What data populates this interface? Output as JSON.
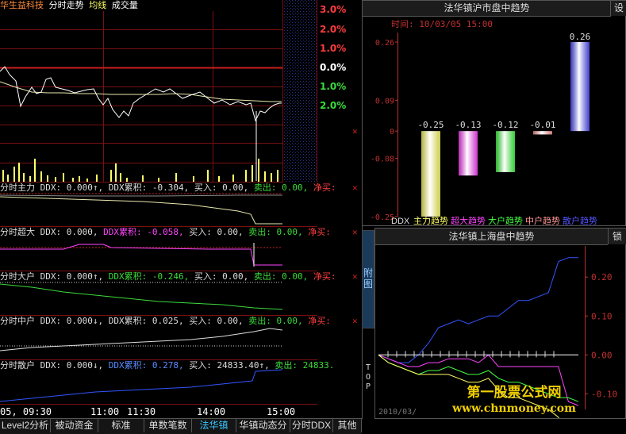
{
  "chart_header": {
    "stock": "华生益科技",
    "mode": "分时走势",
    "avg": "均线",
    "vol": "成交量"
  },
  "price_axis": [
    {
      "label": "3.0%",
      "color": "#ff3b3b"
    },
    {
      "label": "2.0%",
      "color": "#ff3b3b"
    },
    {
      "label": "1.0%",
      "color": "#ff3b3b"
    },
    {
      "label": "0.0%",
      "color": "#ffffff"
    },
    {
      "label": "1.0%",
      "color": "#3bdc3b"
    },
    {
      "label": "2.0%",
      "color": "#3bdc3b"
    }
  ],
  "indicators": [
    {
      "name": "分时主力",
      "ddx_label": "DDX:",
      "ddx": "0.000↑,",
      "cum_label": "DDX累积:",
      "cum": "-0.304,",
      "buy_label": "买入:",
      "buy": "0.00,",
      "sell_label": "卖出:",
      "sell": "0.00,",
      "net": "净买:"
    },
    {
      "name": "分时超大",
      "ddx_label": "DDX:",
      "ddx": "0.000,",
      "cum_label": "DDX累积:",
      "cum": "-0.058,",
      "buy_label": "买入:",
      "buy": "0.00,",
      "sell_label": "卖出:",
      "sell": "0.00,",
      "net": "净买:"
    },
    {
      "name": "分时大户",
      "ddx_label": "DDX:",
      "ddx": "0.000↑,",
      "cum_label": "DDX累积:",
      "cum": "-0.246,",
      "buy_label": "买入:",
      "buy": "0.00,",
      "sell_label": "卖出:",
      "sell": "0.00,",
      "net": "净买:"
    },
    {
      "name": "分时中户",
      "ddx_label": "DDX:",
      "ddx": "0.000↓,",
      "cum_label": "DDX累积:",
      "cum": "0.025,",
      "buy_label": "买入:",
      "buy": "0.00,",
      "sell_label": "卖出:",
      "sell": "0.00,",
      "net": "净买:"
    },
    {
      "name": "分时散户",
      "ddx_label": "DDX:",
      "ddx": "0.000↓,",
      "cum_label": "DDX累积:",
      "cum": "0.278,",
      "buy_label": "买入:",
      "buy": "24833.40↑,",
      "sell_label": "卖出:",
      "sell": "24833.",
      "net": ""
    }
  ],
  "time_axis": [
    "05, 09:30",
    "11:00",
    "11:30",
    "14:00",
    "15:00"
  ],
  "tabs": [
    "Level2分析",
    "被动资金",
    "标准",
    "单数笔数",
    "法华镇",
    "华镇动态分",
    "分时DDX",
    "其他"
  ],
  "active_tab": "法华镇",
  "side_tabs": {
    "attach": "附\n图",
    "top": "T\nO\nP"
  },
  "top_right": {
    "title": "法华镇沪市盘中趋势",
    "settings": "设",
    "time_label": "时间:",
    "time_value": "10/03/05 15:00",
    "y_ticks": [
      "0.26",
      "0.09",
      "0",
      "-0.08",
      "-0.25"
    ],
    "x_label": "DDX"
  },
  "chart_data": [
    {
      "type": "bar",
      "title": "法华镇沪市盘中趋势",
      "categories": [
        "主力趋势",
        "超大趋势",
        "大户趋势",
        "中户趋势",
        "散户趋势"
      ],
      "values": [
        -0.25,
        -0.13,
        -0.12,
        -0.01,
        0.26
      ],
      "value_labels": [
        "-0.25",
        "-0.13",
        "-0.12",
        "-0.01",
        "0.26"
      ],
      "colors": [
        "#ffff66",
        "#ff44ff",
        "#44ff44",
        "#ff9999",
        "#5555ff"
      ],
      "ylim": [
        -0.25,
        0.26
      ]
    },
    {
      "type": "line",
      "title": "法华镇上海盘中趋势",
      "y_ticks": [
        "0.20",
        "0.10",
        "0.00",
        "-0.10"
      ],
      "ylim": [
        -0.14,
        0.28
      ],
      "series": [
        {
          "color": "#3355ff",
          "values": [
            0.0,
            -0.01,
            -0.02,
            -0.02,
            0.0,
            0.03,
            0.07,
            0.08,
            0.09,
            0.08,
            0.09,
            0.1,
            0.1,
            0.12,
            0.14,
            0.14,
            0.15,
            0.16,
            0.24,
            0.25,
            0.25
          ]
        },
        {
          "color": "#ff44ff",
          "values": [
            0.0,
            -0.01,
            -0.02,
            -0.03,
            -0.03,
            -0.02,
            -0.02,
            -0.01,
            -0.01,
            -0.01,
            -0.02,
            0.0,
            -0.03,
            -0.03,
            -0.03,
            -0.03,
            -0.03,
            -0.03,
            -0.03,
            -0.12,
            -0.13
          ]
        },
        {
          "color": "#44ff44",
          "values": [
            0.0,
            -0.02,
            -0.03,
            -0.04,
            -0.05,
            -0.04,
            -0.04,
            -0.03,
            -0.04,
            -0.05,
            -0.05,
            -0.04,
            -0.06,
            -0.07,
            -0.07,
            -0.08,
            -0.09,
            -0.1,
            -0.11,
            -0.11,
            -0.12
          ]
        },
        {
          "color": "#ffff66",
          "values": [
            0.0,
            -0.02,
            -0.03,
            -0.04,
            -0.05,
            -0.05,
            -0.05,
            -0.05,
            -0.06,
            -0.07,
            -0.07,
            -0.06,
            -0.09,
            -0.11,
            -0.11,
            -0.12,
            -0.13,
            -0.14,
            -0.16,
            -0.23,
            -0.25
          ]
        },
        {
          "color": "#ffffff",
          "values": [
            0.0,
            0.0,
            0.0,
            0.0,
            0.0,
            0.0,
            0.0,
            0.0,
            0.0,
            0.0,
            0.0,
            0.0,
            0.0,
            0.0,
            0.0,
            0.0,
            0.0,
            0.0,
            0.0,
            0.0,
            0.0
          ]
        }
      ]
    }
  ],
  "bottom_right": {
    "title": "法华镇上海盘中趋势",
    "lock": "锁",
    "date_stub": "2010/03/"
  },
  "watermark": {
    "line1": "第一股票公式网",
    "line2": "www.chnmoney.com"
  }
}
